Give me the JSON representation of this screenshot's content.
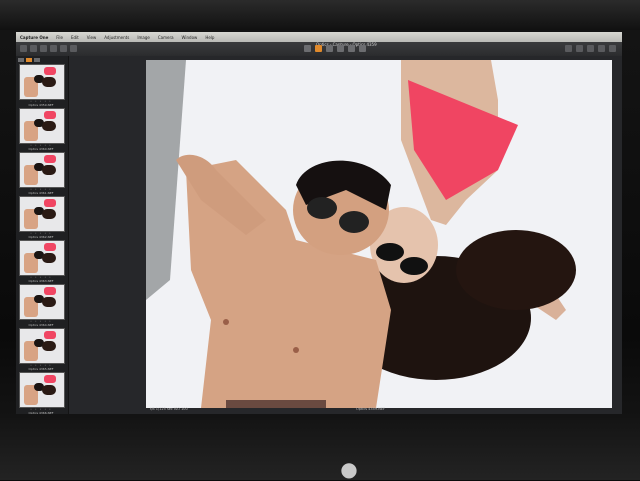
{
  "app": {
    "name": "Capture One",
    "window_title": "Optics - Capture - Optics 4359"
  },
  "menu": {
    "items": [
      "Capture One",
      "File",
      "Edit",
      "View",
      "Adjustments",
      "Image",
      "Camera",
      "Window",
      "Help"
    ]
  },
  "filmstrip": {
    "thumbnails": [
      {
        "label": "Optics 4359.NEF",
        "stars": "• • • • •"
      },
      {
        "label": "Optics 4360.NEF",
        "stars": "• • • • •"
      },
      {
        "label": "Optics 4361.NEF",
        "stars": "• • • • •"
      },
      {
        "label": "Optics 4362.NEF",
        "stars": "• • • • •"
      },
      {
        "label": "Optics 4363.NEF",
        "stars": "• • • • •"
      },
      {
        "label": "Optics 4364.NEF",
        "stars": "• • • • •"
      },
      {
        "label": "Optics 4365.NEF",
        "stars": "• • • • •"
      },
      {
        "label": "Optics 4366.NEF",
        "stars": "• • • • •"
      }
    ]
  },
  "viewer": {
    "status_left": "f/8  1/125 sec  ISO 100",
    "status_center": "Optics 4359.NEF"
  },
  "colors": {
    "accent": "#e08a2c",
    "swimsuit": "#f04562"
  }
}
